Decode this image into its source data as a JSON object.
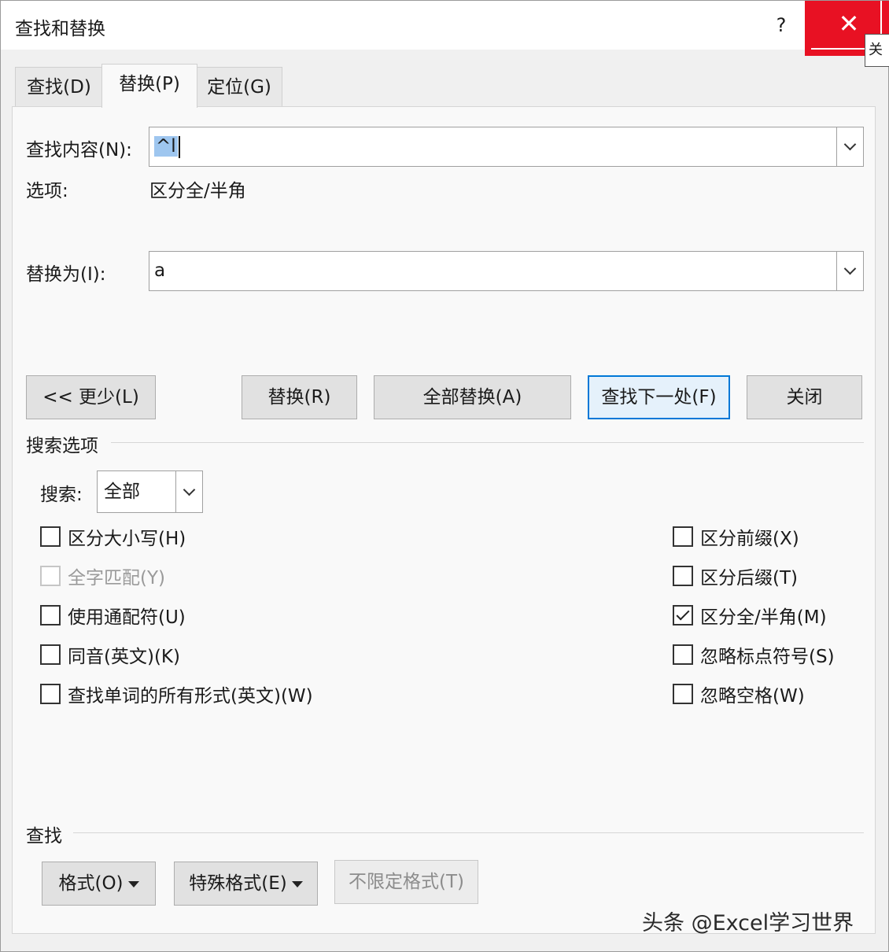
{
  "window": {
    "title": "查找和替换",
    "help": "?",
    "close": "✕",
    "tooltip_fragment": "关"
  },
  "tabs": [
    {
      "label": "查找(D)"
    },
    {
      "label": "替换(P)"
    },
    {
      "label": "定位(G)"
    }
  ],
  "find": {
    "label": "查找内容(N):",
    "value": "^l",
    "options_label": "选项:",
    "options_value": "区分全/半角"
  },
  "replace": {
    "label": "替换为(I):",
    "value": "a"
  },
  "buttons": {
    "less": "<< 更少(L)",
    "replace": "替换(R)",
    "replace_all": "全部替换(A)",
    "find_next": "查找下一处(F)",
    "close": "关闭"
  },
  "search_options": {
    "title": "搜索选项",
    "search_label": "搜索:",
    "search_value": "全部",
    "left": [
      {
        "label": "区分大小写(H)",
        "checked": false,
        "enabled": true
      },
      {
        "label": "全字匹配(Y)",
        "checked": false,
        "enabled": false
      },
      {
        "label": "使用通配符(U)",
        "checked": false,
        "enabled": true
      },
      {
        "label": "同音(英文)(K)",
        "checked": false,
        "enabled": true
      },
      {
        "label": "查找单词的所有形式(英文)(W)",
        "checked": false,
        "enabled": true
      }
    ],
    "right": [
      {
        "label": "区分前缀(X)",
        "checked": false,
        "enabled": true
      },
      {
        "label": "区分后缀(T)",
        "checked": false,
        "enabled": true
      },
      {
        "label": "区分全/半角(M)",
        "checked": true,
        "enabled": true
      },
      {
        "label": "忽略标点符号(S)",
        "checked": false,
        "enabled": true
      },
      {
        "label": "忽略空格(W)",
        "checked": false,
        "enabled": true
      }
    ]
  },
  "find_section": {
    "title": "查找",
    "format": "格式(O)",
    "special": "特殊格式(E)",
    "no_format": "不限定格式(T)"
  },
  "watermark": "头条 @Excel学习世界",
  "colors": {
    "close_red": "#e81123",
    "default_border": "#0078d7",
    "selection": "#9ec6ef"
  }
}
